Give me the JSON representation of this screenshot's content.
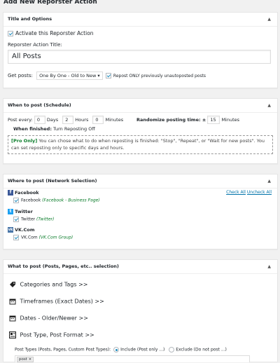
{
  "page": {
    "title": "Add New Reporster Action"
  },
  "title_options": {
    "header": "Title and Options",
    "activate_label": "Activate this Reporster Action",
    "title_label": "Reporster Action Title:",
    "title_value": "All Posts",
    "get_posts_label": "Get posts:",
    "get_posts_value": "One By One - Old to New",
    "repost_only_label": "Repost ONLY previously unautoposted posts"
  },
  "schedule": {
    "header": "When to post (Schedule)",
    "post_every_label": "Post every:",
    "days_value": "0",
    "days_label": "Days",
    "hours_value": "2",
    "hours_label": "Hours",
    "minutes_value": "0",
    "minutes_label": "Minutes",
    "randomize_label": "Randomize posting time: ±",
    "randomize_value": "15",
    "randomize_unit": "Minutes",
    "when_finished_label": "When finished:",
    "when_finished_value": "Turn Reposting Off",
    "pro_tag": "[Pro Only]",
    "pro_text": "You can chose what to do when reposting is finished: \"Stop\", \"Repeat\", or \"Wait for new posts\". You can set reposting only to specific days and hours."
  },
  "network": {
    "header": "Where to post (Network Selection)",
    "check_all": "Check All",
    "uncheck_all": "Uncheck All",
    "networks": [
      {
        "name": "Facebook",
        "account": "Facebook",
        "detail": "(Facebook - Business Page)",
        "color": "#3b5998",
        "icon": "facebook-icon"
      },
      {
        "name": "Twitter",
        "account": "Twitter",
        "detail": "(Twitter)",
        "color": "#1da1f2",
        "icon": "twitter-icon"
      },
      {
        "name": "VK.Com",
        "account": "VK.Com",
        "detail": "(VK.Com Group)",
        "color": "#4a76a8",
        "icon": "vk-icon"
      }
    ]
  },
  "what_to_post": {
    "header": "What to post (Posts, Pages, etc.. selection)",
    "sections": [
      {
        "label": "Categories and Tags",
        "arrow": ">>",
        "icon": "tag-icon"
      },
      {
        "label": "Timeframes (Exact Dates)",
        "arrow": ">>",
        "icon": "calendar-icon"
      },
      {
        "label": "Dates - Older/Newer",
        "arrow": ">>",
        "icon": "calendar-icon"
      },
      {
        "label": "Post Type, Post Format",
        "arrow": ">>",
        "icon": "post-type-icon"
      }
    ],
    "post_types_label": "Post Types (Posts, Pages, Custom Post Types):",
    "include_label": "Include (Post only ...)",
    "exclude_label": "Exclude (Do not post ...)",
    "token": "post",
    "token_remove": "×"
  }
}
